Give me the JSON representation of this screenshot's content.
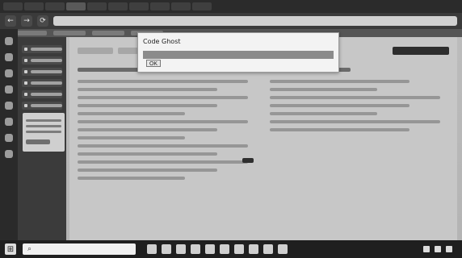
{
  "browser": {
    "tabs": [
      "",
      "",
      "",
      "",
      "",
      "",
      "",
      "",
      "",
      ""
    ],
    "url": "",
    "nav": {
      "back": "←",
      "forward": "→",
      "reload": "⟳"
    }
  },
  "dialog": {
    "title": "Code Ghost",
    "input_value": "",
    "ok_label": "OK"
  },
  "taskbar": {
    "search_placeholder": "",
    "time": "",
    "date": ""
  }
}
